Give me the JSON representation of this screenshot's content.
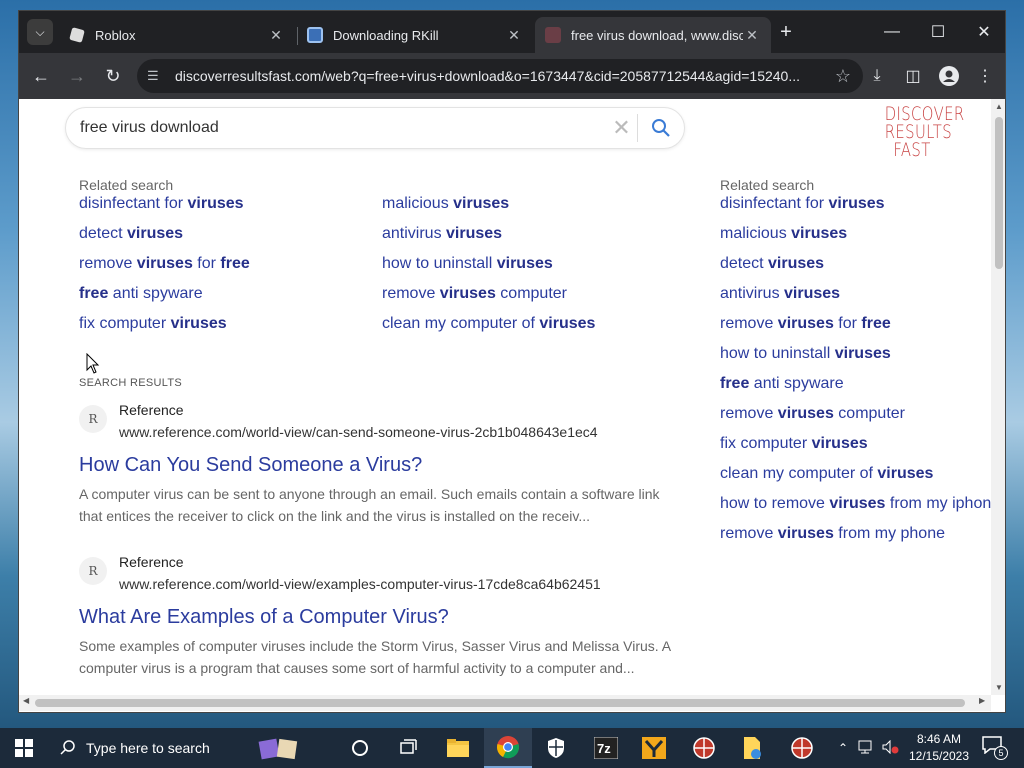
{
  "browser": {
    "tabs": [
      {
        "title": "Roblox",
        "active": false
      },
      {
        "title": "Downloading RKill",
        "active": false
      },
      {
        "title": "free virus download, www.disco",
        "active": true
      }
    ],
    "address": "discoverresultsfast.com/web?q=free+virus+download&o=1673447&cid=20587712544&agid=15240..."
  },
  "search": {
    "query": "free virus download"
  },
  "logo": {
    "line1": "DISCOVER",
    "line2": "RESULTS",
    "line3": "FAST",
    "color": "#c84343"
  },
  "related_left": {
    "heading": "Related search",
    "col1": [
      {
        "pre": "disinfectant for ",
        "bold": "viruses",
        "post": ""
      },
      {
        "pre": "detect ",
        "bold": "viruses",
        "post": ""
      },
      {
        "pre": "remove ",
        "bold": "viruses",
        "post": " for ",
        "bold2": "free"
      },
      {
        "pre": "",
        "bold": "free",
        "post": " anti spyware"
      },
      {
        "pre": "fix computer ",
        "bold": "viruses",
        "post": ""
      }
    ],
    "col2": [
      {
        "pre": "malicious ",
        "bold": "viruses",
        "post": ""
      },
      {
        "pre": "antivirus ",
        "bold": "viruses",
        "post": ""
      },
      {
        "pre": "how to uninstall ",
        "bold": "viruses",
        "post": ""
      },
      {
        "pre": "remove ",
        "bold": "viruses",
        "post": " computer"
      },
      {
        "pre": "clean my computer of ",
        "bold": "viruses",
        "post": ""
      }
    ]
  },
  "related_right": {
    "heading": "Related search",
    "items": [
      {
        "pre": "disinfectant for ",
        "bold": "viruses",
        "post": ""
      },
      {
        "pre": "malicious ",
        "bold": "viruses",
        "post": ""
      },
      {
        "pre": "detect ",
        "bold": "viruses",
        "post": ""
      },
      {
        "pre": "antivirus ",
        "bold": "viruses",
        "post": ""
      },
      {
        "pre": "remove ",
        "bold": "viruses",
        "post": " for ",
        "bold2": "free"
      },
      {
        "pre": "how to uninstall ",
        "bold": "viruses",
        "post": ""
      },
      {
        "pre": "",
        "bold": "free",
        "post": " anti spyware"
      },
      {
        "pre": "remove ",
        "bold": "viruses",
        "post": " computer"
      },
      {
        "pre": "fix computer ",
        "bold": "viruses",
        "post": ""
      },
      {
        "pre": "clean my computer of ",
        "bold": "viruses",
        "post": ""
      },
      {
        "pre": "how to remove ",
        "bold": "viruses",
        "post": " from my iphone"
      },
      {
        "pre": "remove ",
        "bold": "viruses",
        "post": " from my phone"
      }
    ]
  },
  "results": {
    "label": "SEARCH RESULTS",
    "items": [
      {
        "source": "Reference",
        "url": "www.reference.com/world-view/can-send-someone-virus-2cb1b048643e1ec4",
        "title": "How Can You Send Someone a Virus?",
        "desc": "A computer virus can be sent to anyone through an email. Such emails contain a software link that entices the receiver to click on the link and the virus is installed on the receiv..."
      },
      {
        "source": "Reference",
        "url": "www.reference.com/world-view/examples-computer-virus-17cde8ca64b62451",
        "title": "What Are Examples of a Computer Virus?",
        "desc": "Some examples of computer viruses include the Storm Virus, Sasser Virus and Melissa Virus. A computer virus is a program that causes some sort of harmful activity to a computer and..."
      }
    ]
  },
  "taskbar": {
    "search_placeholder": "Type here to search",
    "time": "8:46 AM",
    "date": "12/15/2023",
    "notifications": "5"
  }
}
